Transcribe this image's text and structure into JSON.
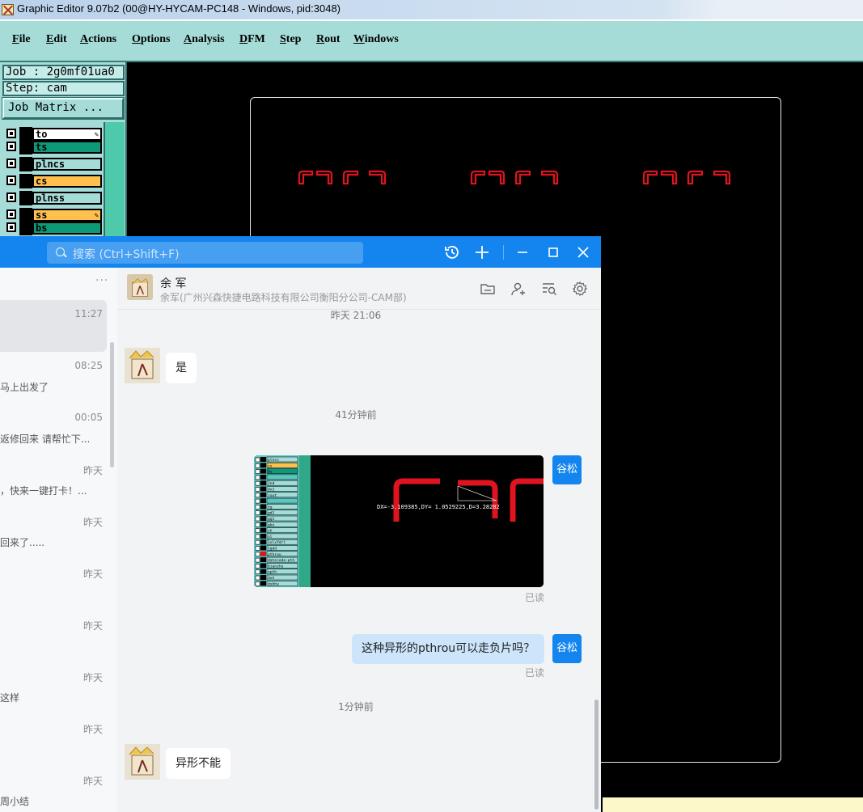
{
  "editor": {
    "window_title": "Graphic Editor 9.07b2 (00@HY-HYCAM-PC148 - Windows, pid:3048)",
    "menu": [
      "File",
      "Edit",
      "Actions",
      "Options",
      "Analysis",
      "DFM",
      "Step",
      "Rout",
      "Windows"
    ],
    "job_label": "Job : 2g0mf01ua0",
    "step_label": "Step: cam",
    "job_matrix_button": "Job Matrix ...",
    "layers": [
      {
        "name": "to",
        "color": "#ffffff",
        "flag": true
      },
      {
        "name": "ts",
        "color": "#0e9a77",
        "flag": false
      },
      {
        "name": "plncs",
        "color": "#a6dcd8",
        "flag": false
      },
      {
        "name": "cs",
        "color": "#ffc04d",
        "flag": false
      },
      {
        "name": "plnss",
        "color": "#a6dcd8",
        "flag": false
      },
      {
        "name": "ss",
        "color": "#ffc04d",
        "flag": true
      },
      {
        "name": "bs",
        "color": "#0e9a77",
        "flag": false
      }
    ],
    "shape_color": "#e0141e"
  },
  "chat": {
    "search_placeholder": "搜索 (Ctrl+Shift+F)",
    "accent": "#1485ee",
    "conversation_list": {
      "more_label": "···",
      "items": [
        {
          "time": "11:27",
          "preview": "",
          "active": true
        },
        {
          "time": "08:25",
          "preview": "马上出发了"
        },
        {
          "time": "00:05",
          "preview": "返修回来 请帮忙下..."
        },
        {
          "time": "昨天",
          "preview": "，快来一键打卡！..."
        },
        {
          "time": "昨天",
          "preview": "回来了....."
        },
        {
          "time": "昨天",
          "preview": ""
        },
        {
          "time": "昨天",
          "preview": ""
        },
        {
          "time": "昨天",
          "preview": "这样"
        },
        {
          "time": "昨天",
          "preview": ""
        },
        {
          "time": "昨天",
          "preview": "周小结"
        }
      ]
    },
    "contact": {
      "name": "余 军",
      "org": "余军(广州兴森快捷电路科技有限公司衡阳分公司-CAM部)"
    },
    "messages": {
      "time_top": "昨天 21:06",
      "msg1": "是",
      "time_2": "41分钟前",
      "me_label": "谷松",
      "image_caption_readout": "DX=-3.109385,DY= 1.0529225,D=3.28282",
      "image_layers": [
        "plnss",
        "ss",
        "bs",
        "",
        "2nd",
        "dx1",
        "rout",
        "",
        "tg",
        "gd1",
        "gg1",
        "gkn",
        "sh",
        "nl",
        "1xlxfdrl",
        "tgdd",
        "pthrou",
        "datecode-pth",
        "bianzhu",
        "npth",
        "dxh",
        "dxhhy"
      ],
      "read_1": "已读",
      "msg_question": "这种异形的pthrou可以走负片吗？",
      "read_2": "已读",
      "time_3": "1分钟前",
      "msg_answer": "异形不能"
    }
  }
}
